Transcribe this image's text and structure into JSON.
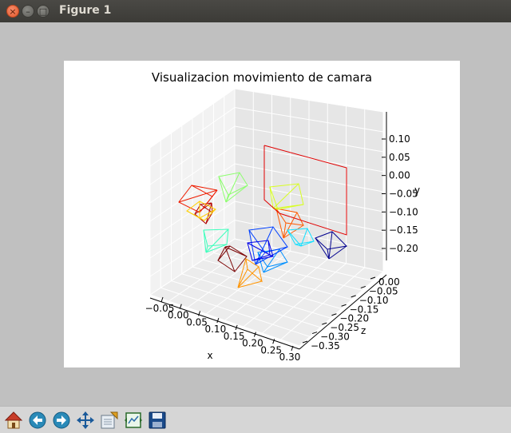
{
  "window": {
    "title": "Figure 1",
    "close_glyph": "×",
    "min_glyph": "–",
    "max_glyph": "□"
  },
  "chart_data": {
    "type": "scatter",
    "title": "Visualizacion movimiento de camara",
    "xlabel": "x",
    "ylabel": "z",
    "zlabel": "y",
    "x_ticks": [
      "−0.05",
      "0.00",
      "0.05",
      "0.10",
      "0.15",
      "0.20",
      "0.25",
      "0.30"
    ],
    "y_ticks": [
      "−0.35",
      "−0.30",
      "−0.25",
      "−0.20",
      "−0.15",
      "−0.10",
      "−0.05",
      "0.00"
    ],
    "z_ticks": [
      "0.10",
      "0.05",
      "0.00",
      "−0.05",
      "−0.10",
      "−0.15",
      "−0.20"
    ],
    "xlim": [
      -0.08,
      0.3
    ],
    "ylim": [
      -0.37,
      0.02
    ],
    "zlim": [
      -0.23,
      0.13
    ],
    "grid": true,
    "camera_colormap": "jet",
    "cameras": [
      {
        "color": "#7a0000"
      },
      {
        "color": "#b00000"
      },
      {
        "color": "#ee1c00"
      },
      {
        "color": "#ff5a00"
      },
      {
        "color": "#ff9400"
      },
      {
        "color": "#ffd000"
      },
      {
        "color": "#d8ff20"
      },
      {
        "color": "#8bff6c"
      },
      {
        "color": "#3cffbc"
      },
      {
        "color": "#12e0ff"
      },
      {
        "color": "#0090ff"
      },
      {
        "color": "#0040ff"
      },
      {
        "color": "#0000e8"
      },
      {
        "color": "#00008f"
      }
    ]
  },
  "toolbar": {
    "buttons": [
      {
        "name": "home-button",
        "icon": "home-icon"
      },
      {
        "name": "back-button",
        "icon": "arrow-left-icon"
      },
      {
        "name": "forward-button",
        "icon": "arrow-right-icon"
      },
      {
        "name": "pan-button",
        "icon": "move-icon"
      },
      {
        "name": "zoom-button",
        "icon": "zoom-rect-icon"
      },
      {
        "name": "subplots-button",
        "icon": "subplots-icon"
      },
      {
        "name": "save-button",
        "icon": "floppy-icon"
      }
    ]
  }
}
